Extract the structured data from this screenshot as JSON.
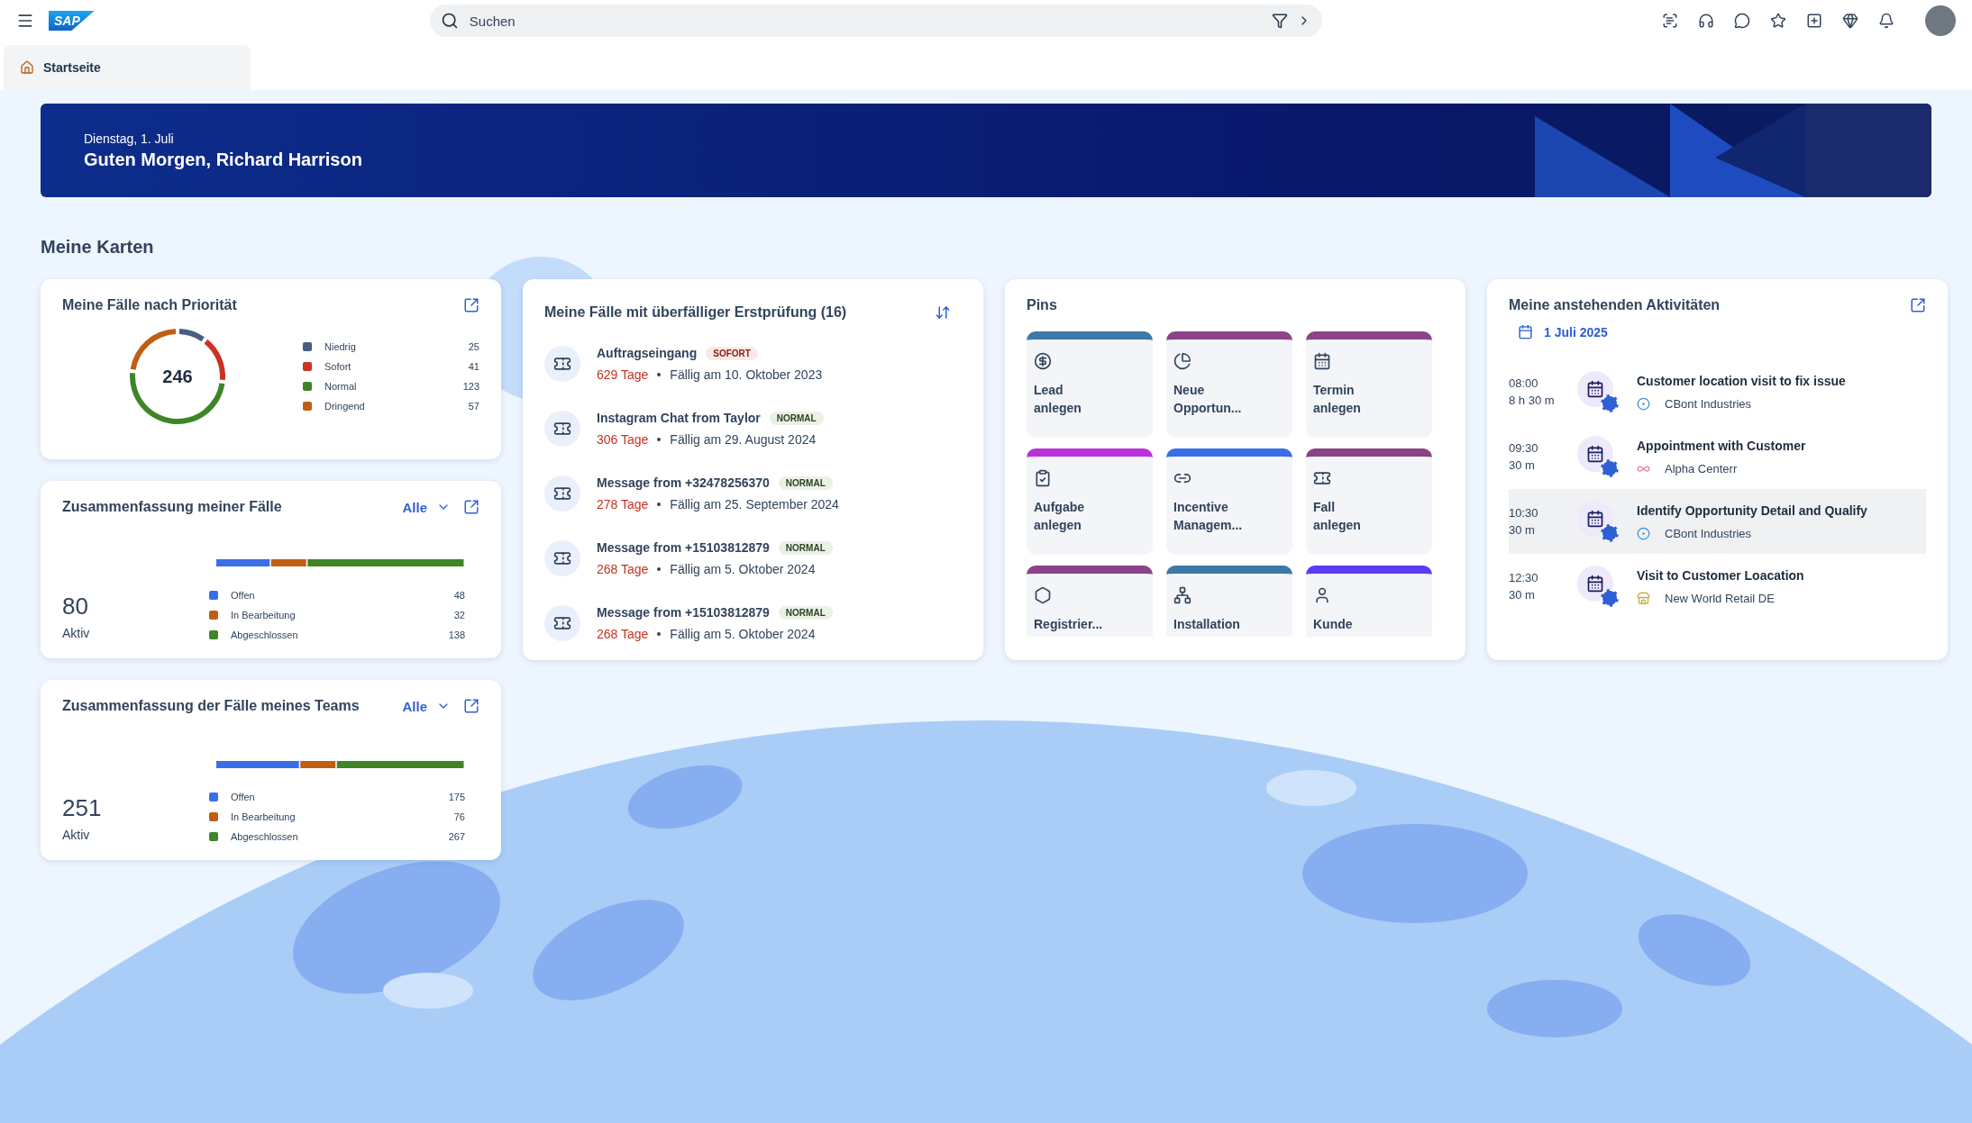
{
  "topbar": {
    "logo": "SAP",
    "search": {
      "placeholder": "Suchen"
    }
  },
  "tabs": [
    {
      "label": "Startseite",
      "selected": true
    }
  ],
  "banner": {
    "date": "Dienstag, 1. Juli",
    "greeting": "Guten Morgen, Richard Harrison"
  },
  "section_title": "Meine Karten",
  "priority_card": {
    "title": "Meine Fälle nach Priorität",
    "total": "246",
    "legend": [
      {
        "label": "Niedrig",
        "value": "25",
        "color": "#4a5d7e"
      },
      {
        "label": "Sofort",
        "value": "41",
        "color": "#cc3222"
      },
      {
        "label": "Normal",
        "value": "123",
        "color": "#3f8527"
      },
      {
        "label": "Dringend",
        "value": "57",
        "color": "#c05e14"
      }
    ]
  },
  "summary_cards": [
    {
      "title": "Zusammenfassung meiner Fälle",
      "filter": "Alle",
      "count": "80",
      "count_label": "Aktiv",
      "legend": [
        {
          "label": "Offen",
          "value": "48",
          "color": "#3a6ee8"
        },
        {
          "label": "In Bearbeitung",
          "value": "32",
          "color": "#c05e14"
        },
        {
          "label": "Abgeschlossen",
          "value": "138",
          "color": "#3f8527"
        }
      ]
    },
    {
      "title": "Zusammenfassung der Fälle meines Teams",
      "filter": "Alle",
      "count": "251",
      "count_label": "Aktiv",
      "legend": [
        {
          "label": "Offen",
          "value": "175",
          "color": "#3a6ee8"
        },
        {
          "label": "In Bearbeitung",
          "value": "76",
          "color": "#c05e14"
        },
        {
          "label": "Abgeschlossen",
          "value": "267",
          "color": "#3f8527"
        }
      ]
    }
  ],
  "overdue_card": {
    "title": "Meine Fälle mit überfälliger Erstprüfung (16)",
    "items": [
      {
        "title": "Auftragseingang",
        "badge": "SOFORT",
        "kind": "urgent",
        "days": "629 Tage",
        "due": "Fällig am 10. Oktober 2023"
      },
      {
        "title": "Instagram Chat from Taylor",
        "badge": "NORMAL",
        "kind": "normal",
        "days": "306 Tage",
        "due": "Fällig am 29. August 2024"
      },
      {
        "title": "Message from +32478256370",
        "badge": "NORMAL",
        "kind": "normal",
        "days": "278 Tage",
        "due": "Fällig am 25. September 2024"
      },
      {
        "title": "Message from +15103812879",
        "badge": "NORMAL",
        "kind": "normal",
        "days": "268 Tage",
        "due": "Fällig am 5. Oktober 2024"
      },
      {
        "title": "Message from +15103812879",
        "badge": "NORMAL",
        "kind": "normal",
        "days": "268 Tage",
        "due": "Fällig am 5. Oktober 2024"
      }
    ]
  },
  "pins": {
    "title": "Pins",
    "items": [
      {
        "label": "Lead anlegen",
        "color": "#3c79a6"
      },
      {
        "label": "Neue Opportun...",
        "color": "#8a4487"
      },
      {
        "label": "Termin anlegen",
        "color": "#8a4487"
      },
      {
        "label": "Aufgabe anlegen",
        "color": "#b832d8"
      },
      {
        "label": "Incentive Managem...",
        "color": "#3a6ee8"
      },
      {
        "label": "Fall anlegen",
        "color": "#8a4487"
      },
      {
        "label": "Registrier...",
        "color": "#8a4487"
      },
      {
        "label": "Installation",
        "color": "#3c79a6"
      },
      {
        "label": "Kunde",
        "color": "#5b3bf5"
      }
    ]
  },
  "activities": {
    "title": "Meine anstehenden Aktivitäten",
    "date": "1 Juli 2025",
    "items": [
      {
        "time": "08:00",
        "duration": "8 h 30 m",
        "title": "Customer location visit to fix issue",
        "company": "CBont Industries",
        "selected": false
      },
      {
        "time": "09:30",
        "duration": "30 m",
        "title": "Appointment with Customer",
        "company": "Alpha Centerr",
        "selected": false
      },
      {
        "time": "10:30",
        "duration": "30 m",
        "title": "Identify Opportunity Detail and Qualify",
        "company": "CBont Industries",
        "selected": true
      },
      {
        "time": "12:30",
        "duration": "30 m",
        "title": "Visit to Customer Loacation",
        "company": "New World Retail DE",
        "selected": false
      }
    ]
  }
}
